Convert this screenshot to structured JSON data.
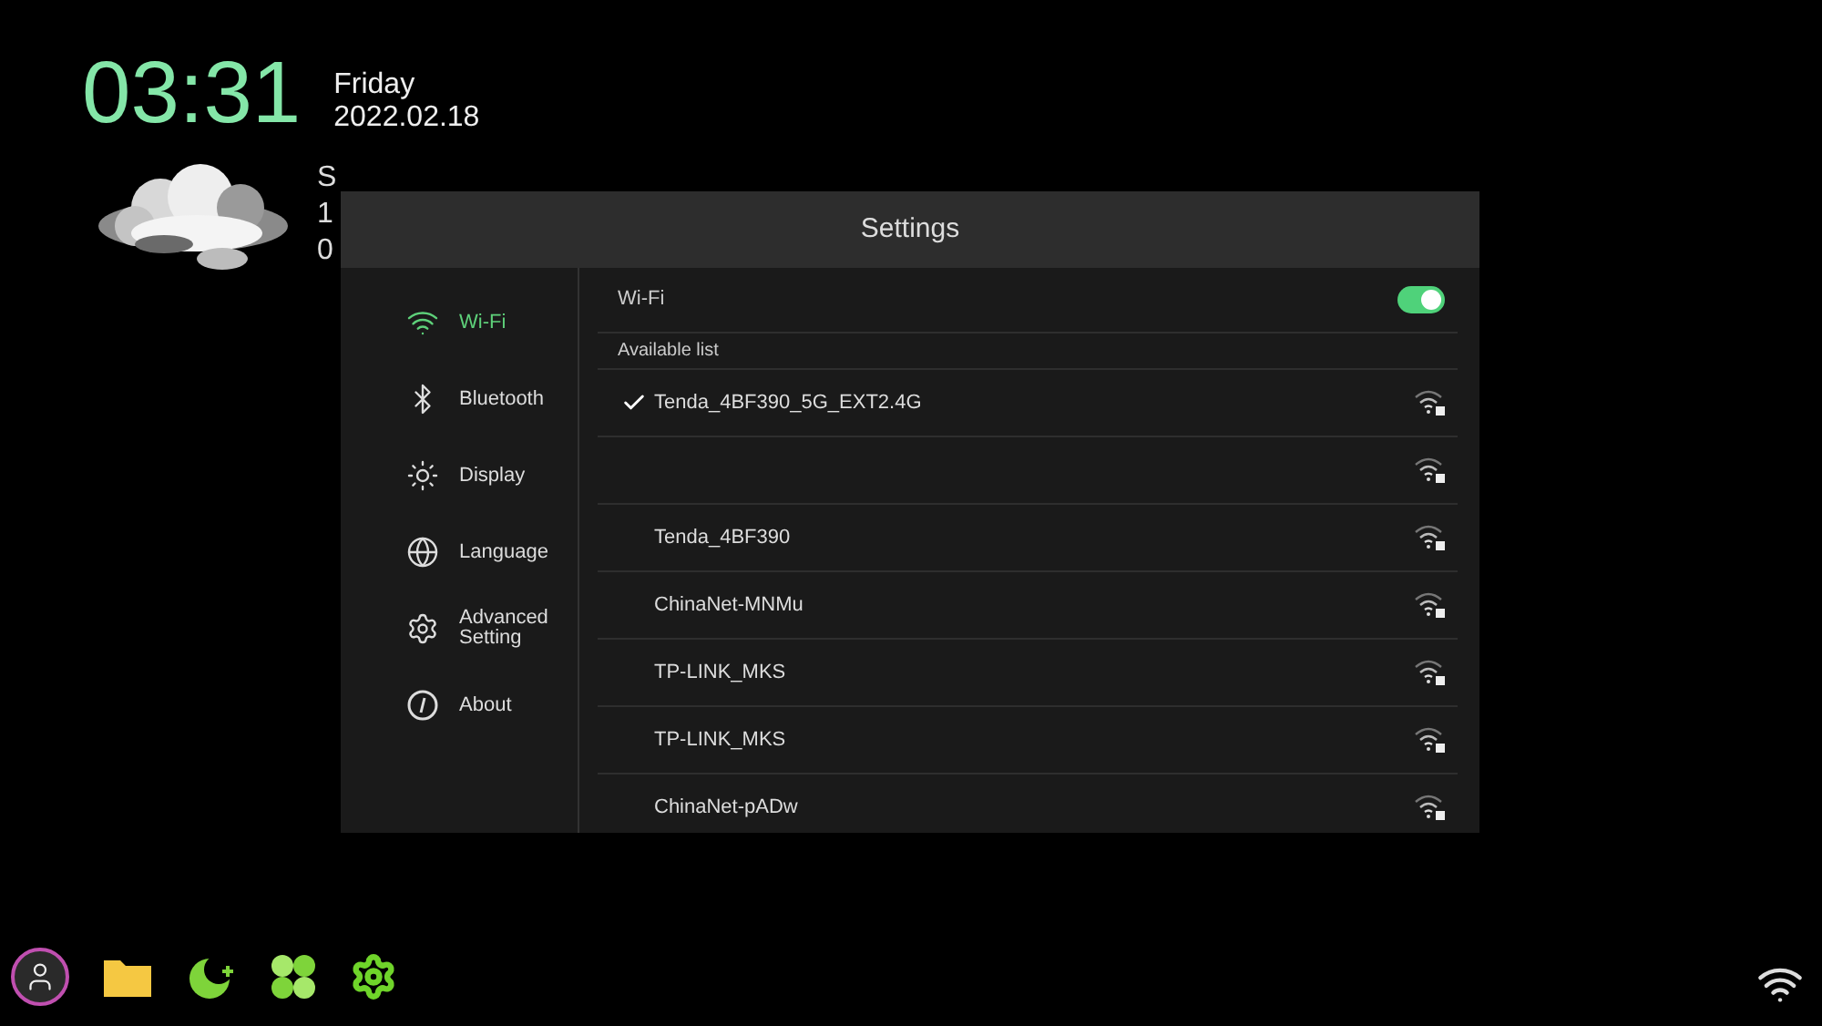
{
  "clock": {
    "time": "03:31",
    "day": "Friday",
    "date": "2022.02.18"
  },
  "weather": {
    "lines": [
      "S",
      "1",
      "0"
    ]
  },
  "settings": {
    "title": "Settings",
    "sidebar": {
      "items": [
        {
          "label": "Wi-Fi",
          "kind": "wifi",
          "selected": true
        },
        {
          "label": "Bluetooth",
          "kind": "bluetooth",
          "selected": false
        },
        {
          "label": "Display",
          "kind": "display",
          "selected": false
        },
        {
          "label": "Language",
          "kind": "language",
          "selected": false
        },
        {
          "label": "Advanced Setting",
          "kind": "advanced",
          "selected": false
        },
        {
          "label": "About",
          "kind": "about",
          "selected": false
        }
      ]
    },
    "wifi": {
      "label": "Wi-Fi",
      "on": true
    },
    "available_label": "Available list",
    "networks": [
      {
        "name": "Tenda_4BF390_5G_EXT2.4G",
        "selected": true
      },
      {
        "selected": false
      },
      {
        "name": "Tenda_4BF390",
        "selected": false
      },
      {
        "name": "ChinaNet-MNMu",
        "selected": false
      },
      {
        "name": "TP-LINK_MKS",
        "selected": false
      },
      {
        "name": "TP-LINK_MKS",
        "selected": false
      },
      {
        "name": "ChinaNet-pADw",
        "selected": false
      }
    ]
  },
  "dock": [
    {
      "kind": "user"
    },
    {
      "kind": "folder"
    },
    {
      "kind": "leaf"
    },
    {
      "kind": "clover"
    },
    {
      "kind": "gear"
    }
  ]
}
